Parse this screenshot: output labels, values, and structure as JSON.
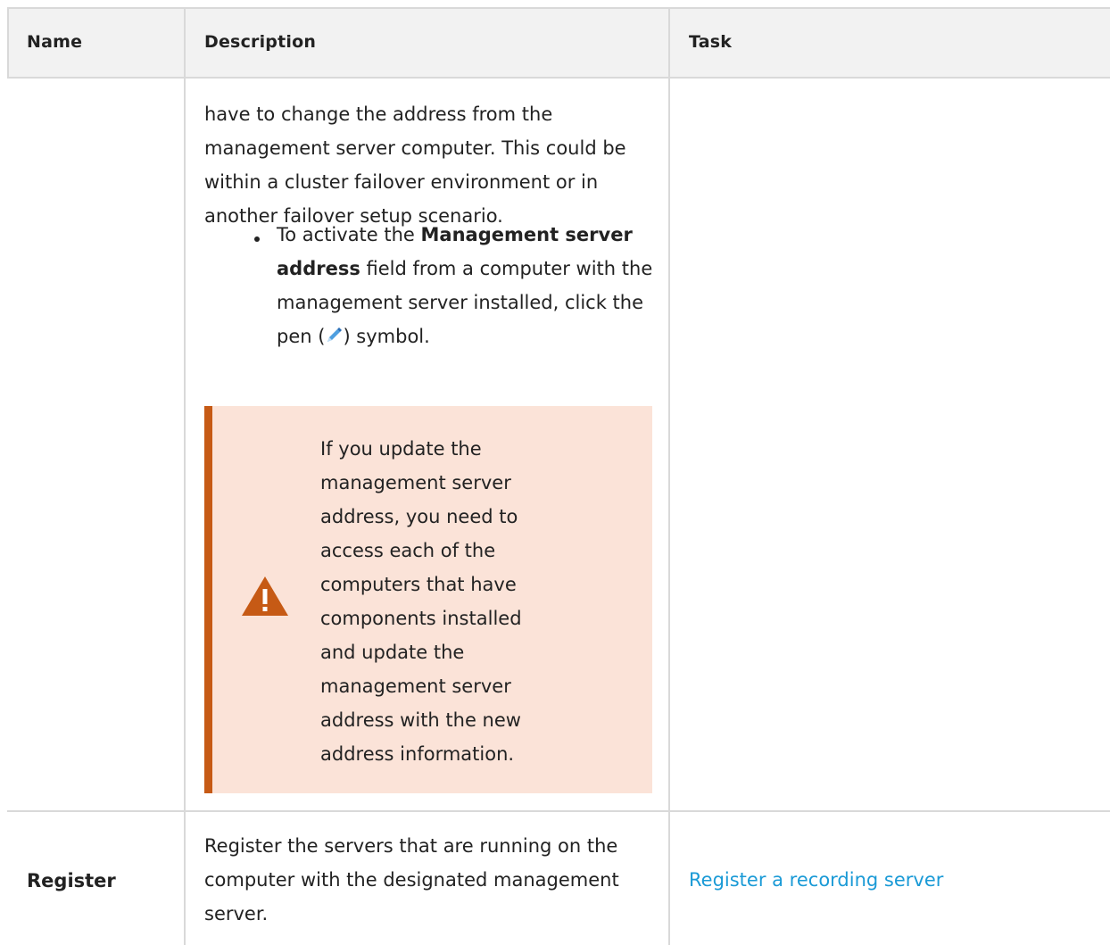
{
  "table": {
    "headers": {
      "name": "Name",
      "description": "Description",
      "task": "Task"
    },
    "row1": {
      "paragraph": "have to change the address from the management server computer. This could be within a cluster failover environment or in another failover setup scenario.",
      "bullet": {
        "before": "To activate the ",
        "bold": "Management server address",
        "middle": " field from a computer with the management server installed, click the pen (",
        "after": ") symbol.",
        "icon": "pen-icon"
      },
      "warning": {
        "icon": "warning-triangle-icon",
        "text": "If you update the management server address, you need to access each of the computers that have components installed and update the management server address with the new address information.",
        "accent_color": "#c65a15",
        "background_color": "#fbe3d8"
      }
    },
    "row2": {
      "name": "Register",
      "description": "Register the servers that are running on the computer with the designated management server.",
      "task_link": "Register a recording server",
      "link_color": "#1a9ad6"
    }
  }
}
